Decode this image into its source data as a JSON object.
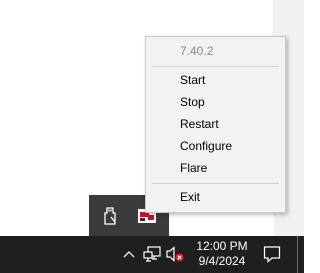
{
  "context_menu": {
    "version": "7.40.2",
    "items": [
      {
        "label": "Start"
      },
      {
        "label": "Stop"
      },
      {
        "label": "Restart"
      },
      {
        "label": "Configure"
      },
      {
        "label": "Flare"
      }
    ],
    "exit_label": "Exit"
  },
  "tray_overflow": {
    "icons": [
      "usb-drive-icon",
      "app-tray-icon"
    ]
  },
  "taskbar": {
    "icons": [
      "chevron-up-icon",
      "network-icon",
      "volume-muted-icon",
      "notification-icon"
    ],
    "clock_time": "12:00 PM",
    "clock_date": "9/4/2024"
  },
  "colors": {
    "taskbar_bg": "#1f1f1f",
    "menu_bg": "#f2f2f2",
    "overflow_bg": "#3b3b3b",
    "app_icon_red": "#c8102e",
    "mute_badge_red": "#e81123"
  }
}
